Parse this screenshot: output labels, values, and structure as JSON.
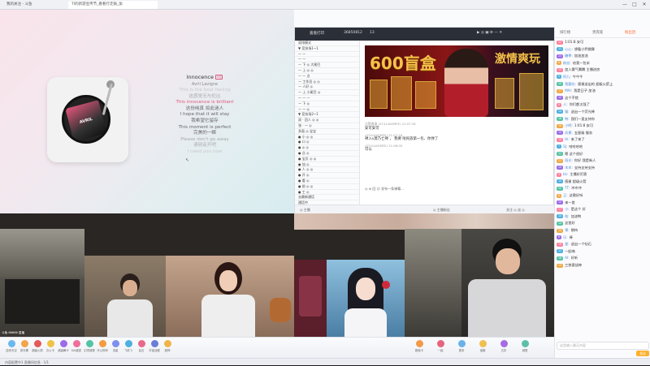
{
  "browser": {
    "tabs": [
      {
        "label": "我的关注 - 斗鱼"
      },
      {
        "label": "TI的新游宣传节_看看行走锅_加"
      }
    ],
    "window_controls": [
      "—",
      "□",
      "✕"
    ]
  },
  "music": {
    "title": "Innocence",
    "quality_badge": "HQ",
    "artist": "Avril Lavigne",
    "album_art_text": "AVRIL LAVIGNE",
    "lyrics": [
      {
        "text": "This is the best feeling",
        "state": "very-faded"
      },
      {
        "text": "这感觉无与伦比",
        "state": "faded"
      },
      {
        "text": "This innocence is brilliant",
        "state": "current"
      },
      {
        "text": "这份纯真 如此迷人",
        "state": "normal"
      },
      {
        "text": "I hope that it will stay",
        "state": "normal"
      },
      {
        "text": "我希望它留存",
        "state": "normal"
      },
      {
        "text": "This moment is perfect",
        "state": "normal"
      },
      {
        "text": "完美的一瞬",
        "state": "normal"
      },
      {
        "text": "Please don't go away",
        "state": "faded"
      },
      {
        "text": "请别走开吧",
        "state": "faded"
      },
      {
        "text": "I need you now",
        "state": "very-faded"
      }
    ]
  },
  "player": {
    "top_bar": {
      "left": "嘉嘉打印",
      "room": "36850812",
      "count": "13"
    },
    "left_list": [
      "双排模式",
      "▼ 竞技场1~1",
      "一 一",
      "一 一",
      "一 下 ◎ 大尾巴",
      "一 上 ◎ ◎",
      "一 一 点",
      "一 工作员 ◎ ◎",
      "一 人好 ◎",
      "一 上 小尾巴 ◎",
      "一 一 一",
      "一 下 ◎",
      "一 一 ◎",
      "▼ 竞技场2~1",
      "双 · 回人 ◎ ◎",
      "张 · 一 ◎",
      "多面 ◎ 宝宝",
      "● 小 ◎ ◎",
      "● 口 ◎",
      "● ◎ ◎",
      "● 点 ◎",
      "● 宝贝 ◎ ◎",
      "● 加 ◎",
      "● 人 ◎ ◎",
      "● 开 ◎",
      "● 看 ◎",
      "● 前 ◎ ◎",
      "● 工 ◎",
      "   去最新通话",
      "   通话中"
    ],
    "banner": {
      "left_text": "600盲盒",
      "right_text": "激情爽玩"
    },
    "feed": [
      {
        "user": "点赞邀请 (07414ASMFE) 21:07:18",
        "text": "安可安可"
      },
      {
        "user": "(07414ASMFE) 21:07:18",
        "text": "禅入v莫乃亡禅 ， 我要 啦民族第一包、你弹了"
      },
      {
        "user": "(07414ASMFE) 21:08:00",
        "text": "可以"
      }
    ],
    "tools": "◎ ⊕ 回 ☺   发布一条弹幕...",
    "bottom": {
      "left": "◎ 主播",
      "center": "◎ 主播粉丝",
      "right": "关注 ◎ 送 ◎"
    }
  },
  "cams": [
    {
      "label": "斗鱼 66666 直播"
    },
    {
      "label": ""
    },
    {
      "label": ""
    },
    {
      "label": ""
    },
    {
      "label": ""
    },
    {
      "label": ""
    }
  ],
  "gifts": [
    {
      "label": "送你天空",
      "color": "#6bb8f0"
    },
    {
      "label": "荧光棒",
      "color": "#f2a54a"
    },
    {
      "label": "超级火箭",
      "color": "#e45a5a"
    },
    {
      "label": "办公卡",
      "color": "#f0c244"
    },
    {
      "label": "超级舞卡",
      "color": "#9c6be8"
    },
    {
      "label": "KAI盛宴",
      "color": "#ef6f9a"
    },
    {
      "label": "幻境城堡",
      "color": "#55c3a5"
    },
    {
      "label": "可以的呀",
      "color": "#f59b43"
    },
    {
      "label": "流星",
      "color": "#7d8ff0"
    },
    {
      "label": "飞机飞",
      "color": "#4fb0e0"
    },
    {
      "label": "钻石",
      "color": "#e86a8a"
    },
    {
      "label": "宇宙战舰",
      "color": "#6a7dd8"
    },
    {
      "label": "超神",
      "color": "#f0b54a"
    }
  ],
  "right_gifts": [
    {
      "label": "颜值卡",
      "color": "#f29a4a"
    },
    {
      "label": "一起",
      "color": "#e5647e"
    },
    {
      "label": "更多",
      "color": "#6bb2e8"
    },
    {
      "label": "宝箱",
      "color": "#f0c050"
    },
    {
      "label": "五折",
      "color": "#a66be2"
    },
    {
      "label": "城堡",
      "color": "#5cc0a8"
    }
  ],
  "notice": "内容配置中1 直播间信息 · 1/1",
  "chat": {
    "tabs": [
      "排行榜",
      "贵宾席",
      "粉丝团"
    ],
    "active_tab": 2,
    "messages": [
      {
        "badge": "12",
        "badge_color": "#ff7f9d",
        "user": "",
        "text": "1:01:8 安可"
      },
      {
        "badge": "11",
        "badge_color": "#4fb0e0",
        "user": "心心:",
        "text": "想看小乔跳舞"
      },
      {
        "badge": "23",
        "badge_color": "#9c6be8",
        "user": "糖果:",
        "text": "加油加油"
      },
      {
        "badge": "8",
        "badge_color": "#f0a844",
        "user": "粉丝:",
        "text": "给我一包米"
      },
      {
        "badge": "15",
        "badge_color": "#ff7f9d",
        "user": "",
        "text": "加入雾气腾腾 主播进房"
      },
      {
        "badge": "9",
        "badge_color": "#4fb0e0",
        "user": "阿九:",
        "text": "牛牛牛"
      },
      {
        "badge": "20",
        "badge_color": "#55c3a5",
        "user": "我要吃:",
        "text": "感谢送出的 超级火箭上"
      },
      {
        "badge": "17",
        "badge_color": "#f0a844",
        "user": "MAI:",
        "text": "我是日子 加油"
      },
      {
        "badge": "12",
        "badge_color": "#9c6be8",
        "user": "",
        "text": "这个不错"
      },
      {
        "badge": "6",
        "badge_color": "#ff7f9d",
        "user": "人:",
        "text": "你们都太强了"
      },
      {
        "badge": "14",
        "badge_color": "#4fb0e0",
        "user": "猫:",
        "text": "送出一个荧光棒"
      },
      {
        "badge": "18",
        "badge_color": "#55c3a5",
        "user": "鸭:",
        "text": "我们一直支持你"
      },
      {
        "badge": "10",
        "badge_color": "#f0a844",
        "user": "小明:",
        "text": "1:01:8 安可"
      },
      {
        "badge": "13",
        "badge_color": "#9c6be8",
        "user": "风景:",
        "text": "五星级 服务"
      },
      {
        "badge": "16",
        "badge_color": "#ff7f9d",
        "user": "Hi:",
        "text": "来了来了"
      },
      {
        "badge": "7",
        "badge_color": "#4fb0e0",
        "user": "SJ:",
        "text": "哈哈哈哈"
      },
      {
        "badge": "21",
        "badge_color": "#55c3a5",
        "user": "",
        "text": "嗯 这个很好"
      },
      {
        "badge": "11",
        "badge_color": "#f0a844",
        "user": "阳光:",
        "text": "你好 我是新人"
      },
      {
        "badge": "19",
        "badge_color": "#9c6be8",
        "user": "木木:",
        "text": "支持支持支持"
      },
      {
        "badge": "9",
        "badge_color": "#ff7f9d",
        "user": "kk:",
        "text": "主播好厉害"
      },
      {
        "badge": "15",
        "badge_color": "#4fb0e0",
        "user": "",
        "text": "感谢 超级火箭"
      },
      {
        "badge": "22",
        "badge_color": "#55c3a5",
        "user": "TT:",
        "text": "冲冲冲"
      },
      {
        "badge": "8",
        "badge_color": "#f0a844",
        "user": "王:",
        "text": "这歌好听"
      },
      {
        "badge": "12",
        "badge_color": "#9c6be8",
        "user": "",
        "text": "来一首"
      },
      {
        "badge": "17",
        "badge_color": "#ff7f9d",
        "user": "小:",
        "text": "是这个 好"
      },
      {
        "badge": "10",
        "badge_color": "#4fb0e0",
        "user": "啦:",
        "text": "加油鸭"
      },
      {
        "badge": "14",
        "badge_color": "#55c3a5",
        "user": "",
        "text": "这首好"
      },
      {
        "badge": "20",
        "badge_color": "#f0a844",
        "user": "果:",
        "text": "期待"
      },
      {
        "badge": "6",
        "badge_color": "#9c6be8",
        "user": "乐:",
        "text": "棒"
      },
      {
        "badge": "18",
        "badge_color": "#ff7f9d",
        "user": "星:",
        "text": "送出一个钻石"
      },
      {
        "badge": "11",
        "badge_color": "#4fb0e0",
        "user": "",
        "text": "一起嗨"
      },
      {
        "badge": "16",
        "badge_color": "#55c3a5",
        "user": "AI:",
        "text": "好听"
      },
      {
        "badge": "13",
        "badge_color": "#f0a844",
        "user": "",
        "text": "三侠客战神"
      }
    ],
    "input_placeholder": "这里输入聊天内容",
    "send_label": "发送"
  }
}
